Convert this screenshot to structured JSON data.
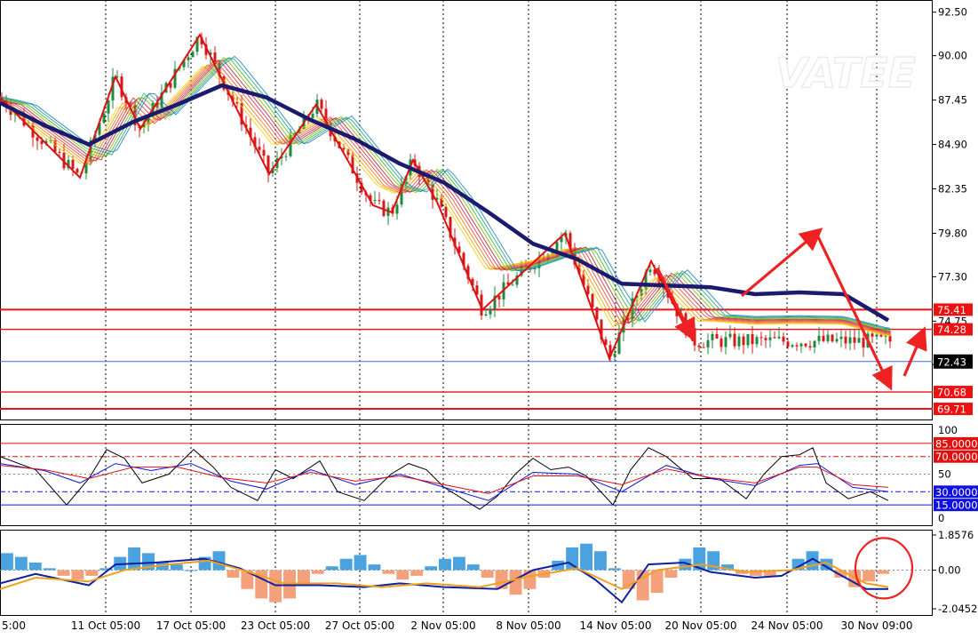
{
  "watermark": "VATEE",
  "colors": {
    "background": "#ffffff",
    "grid": "#000000",
    "bull_candle": "#1e8a3c",
    "bear_candle": "#d41a1a",
    "zigzag": "#dd1111",
    "ma_thick": "#1a1a6e",
    "level_line": "#ee1111",
    "price_line": "#3a6ad8",
    "rsi_black": "#000000",
    "rsi_red": "#e01010",
    "rsi_blue": "#1010e0",
    "macd_pos": "#4aa3df",
    "macd_neg": "#f4a07a",
    "macd_line": "#1020a0",
    "macd_signal": "#f0a020",
    "annotation": "#ee2222"
  },
  "chart_data": [
    {
      "type": "line",
      "panel": "price",
      "x_labels": [
        "5:00",
        "11 Oct 05:00",
        "17 Oct 05:00",
        "23 Oct 05:00",
        "27 Oct 05:00",
        "2 Nov 05:00",
        "8 Nov 05:00",
        "14 Nov 05:00",
        "20 Nov 05:00",
        "24 Nov 05:00",
        "30 Nov 09:00"
      ],
      "y_ticks": [
        "92.50",
        "90.00",
        "87.45",
        "84.90",
        "82.35",
        "79.80",
        "77.30",
        "74.75",
        "72.25"
      ],
      "ylim": [
        69.1,
        93.2
      ],
      "levels": [
        {
          "label": "75.41",
          "value": 75.41
        },
        {
          "label": "74.28",
          "value": 74.28
        },
        {
          "label": "70.68",
          "value": 70.68
        },
        {
          "label": "69.71",
          "value": 69.71
        }
      ],
      "current_price": {
        "label": "72.43",
        "value": 72.43
      },
      "series": [
        {
          "kind": "zigzag",
          "points": [
            [
              0,
              87.6
            ],
            [
              45,
              85.3
            ],
            [
              90,
              83.0
            ],
            [
              130,
              88.8
            ],
            [
              158,
              85.8
            ],
            [
              225,
              91.2
            ],
            [
              303,
              83.2
            ],
            [
              356,
              87.2
            ],
            [
              420,
              81.4
            ],
            [
              441,
              81.0
            ],
            [
              465,
              84.0
            ],
            [
              492,
              81.6
            ],
            [
              543,
              75.4
            ],
            [
              636,
              79.8
            ],
            [
              686,
              72.6
            ],
            [
              733,
              78.2
            ],
            [
              780,
              73.6
            ]
          ]
        },
        {
          "kind": "moving_average",
          "points": [
            [
              0,
              87.3
            ],
            [
              50,
              86.0
            ],
            [
              100,
              84.9
            ],
            [
              150,
              86.2
            ],
            [
              200,
              87.2
            ],
            [
              250,
              88.3
            ],
            [
              300,
              87.6
            ],
            [
              350,
              86.3
            ],
            [
              400,
              85.2
            ],
            [
              450,
              83.8
            ],
            [
              500,
              82.7
            ],
            [
              550,
              81.0
            ],
            [
              600,
              79.2
            ],
            [
              650,
              78.3
            ],
            [
              700,
              76.9
            ],
            [
              750,
              76.8
            ],
            [
              800,
              76.7
            ],
            [
              850,
              76.3
            ],
            [
              900,
              76.4
            ],
            [
              950,
              76.3
            ],
            [
              1000,
              74.8
            ]
          ]
        }
      ],
      "annotation_arrows": [
        [
          [
            740,
            77.8
          ],
          [
            778,
            74.0
          ]
        ],
        [
          [
            835,
            76.2
          ],
          [
            919,
            79.8
          ]
        ],
        [
          [
            919,
            79.8
          ],
          [
            1000,
            71.2
          ]
        ],
        [
          [
            1018,
            71.6
          ],
          [
            1038,
            74.0
          ]
        ]
      ]
    },
    {
      "type": "line",
      "panel": "rsi",
      "y_ticks": [
        "100",
        "50",
        "0"
      ],
      "ylim": [
        0,
        100
      ],
      "levels": [
        {
          "label": "85.0000",
          "value": 85,
          "color": "#e01010"
        },
        {
          "label": "70.0000",
          "value": 70,
          "color": "#e01010"
        },
        {
          "label": "30.0000",
          "value": 30,
          "color": "#1010e0"
        },
        {
          "label": "15.0000",
          "value": 15,
          "color": "#1010e0"
        }
      ],
      "series": [
        {
          "name": "",
          "color": "#000000",
          "points": [
            [
              0,
              70
            ],
            [
              40,
              55
            ],
            [
              75,
              15
            ],
            [
              100,
              45
            ],
            [
              120,
              78
            ],
            [
              140,
              68
            ],
            [
              160,
              40
            ],
            [
              190,
              50
            ],
            [
              218,
              78
            ],
            [
              240,
              58
            ],
            [
              260,
              35
            ],
            [
              290,
              20
            ],
            [
              310,
              55
            ],
            [
              330,
              45
            ],
            [
              360,
              65
            ],
            [
              380,
              30
            ],
            [
              410,
              20
            ],
            [
              440,
              50
            ],
            [
              460,
              62
            ],
            [
              480,
              55
            ],
            [
              500,
              35
            ],
            [
              540,
              10
            ],
            [
              560,
              25
            ],
            [
              580,
              50
            ],
            [
              600,
              68
            ],
            [
              620,
              55
            ],
            [
              640,
              58
            ],
            [
              660,
              48
            ],
            [
              690,
              15
            ],
            [
              710,
              55
            ],
            [
              730,
              80
            ],
            [
              750,
              70
            ],
            [
              780,
              45
            ],
            [
              810,
              45
            ],
            [
              840,
              22
            ],
            [
              860,
              50
            ],
            [
              880,
              70
            ],
            [
              900,
              72
            ],
            [
              915,
              80
            ],
            [
              930,
              40
            ],
            [
              955,
              22
            ],
            [
              980,
              30
            ],
            [
              1000,
              20
            ]
          ]
        },
        {
          "name": "",
          "color": "#1010e0",
          "points": [
            [
              0,
              62
            ],
            [
              50,
              54
            ],
            [
              90,
              40
            ],
            [
              130,
              62
            ],
            [
              170,
              54
            ],
            [
              215,
              62
            ],
            [
              260,
              42
            ],
            [
              300,
              33
            ],
            [
              350,
              55
            ],
            [
              400,
              38
            ],
            [
              450,
              50
            ],
            [
              500,
              35
            ],
            [
              550,
              20
            ],
            [
              600,
              52
            ],
            [
              650,
              50
            ],
            [
              700,
              30
            ],
            [
              750,
              60
            ],
            [
              800,
              45
            ],
            [
              850,
              37
            ],
            [
              900,
              60
            ],
            [
              920,
              62
            ],
            [
              960,
              35
            ],
            [
              1000,
              30
            ]
          ]
        },
        {
          "name": "",
          "color": "#e01010",
          "points": [
            [
              0,
              60
            ],
            [
              50,
              55
            ],
            [
              100,
              45
            ],
            [
              150,
              58
            ],
            [
              200,
              58
            ],
            [
              250,
              46
            ],
            [
              300,
              40
            ],
            [
              350,
              52
            ],
            [
              400,
              42
            ],
            [
              450,
              48
            ],
            [
              500,
              38
            ],
            [
              550,
              28
            ],
            [
              600,
              48
            ],
            [
              650,
              48
            ],
            [
              700,
              38
            ],
            [
              750,
              56
            ],
            [
              800,
              46
            ],
            [
              850,
              40
            ],
            [
              900,
              58
            ],
            [
              920,
              58
            ],
            [
              960,
              38
            ],
            [
              1000,
              35
            ]
          ]
        }
      ]
    },
    {
      "type": "bar",
      "panel": "macd",
      "y_ticks": [
        "1.8576",
        "0.00",
        "-2.0452"
      ],
      "ylim": [
        -2.0452,
        1.8576
      ],
      "histogram": [
        0.9,
        0.7,
        0.4,
        0.1,
        -0.3,
        -0.5,
        -0.3,
        0.1,
        0.7,
        1.2,
        0.9,
        0.4,
        0.3,
        0.0,
        0.7,
        1.0,
        -0.4,
        -1.0,
        -1.5,
        -1.7,
        -1.5,
        -0.8,
        -0.2,
        0.2,
        0.6,
        0.8,
        0.3,
        -0.2,
        -0.5,
        -0.3,
        0.2,
        0.6,
        0.7,
        0.3,
        -0.4,
        -1.0,
        -1.3,
        -1.0,
        -0.4,
        0.5,
        1.2,
        1.4,
        1.0,
        0.1,
        -1.0,
        -1.6,
        -1.2,
        -0.4,
        0.6,
        1.2,
        1.0,
        0.3,
        -0.2,
        -0.3,
        -0.3,
        0.0,
        0.6,
        1.0,
        0.6,
        -0.4,
        -0.9,
        -0.6,
        -0.2
      ],
      "series": [
        {
          "name": "",
          "color": "#1020a0",
          "points": [
            [
              0,
              -0.7
            ],
            [
              40,
              -0.2
            ],
            [
              100,
              -0.8
            ],
            [
              130,
              0.3
            ],
            [
              175,
              0.4
            ],
            [
              230,
              0.6
            ],
            [
              270,
              0.1
            ],
            [
              310,
              -0.8
            ],
            [
              360,
              -0.8
            ],
            [
              410,
              -0.9
            ],
            [
              450,
              -0.7
            ],
            [
              500,
              -0.9
            ],
            [
              560,
              -1.0
            ],
            [
              600,
              0.0
            ],
            [
              640,
              0.4
            ],
            [
              670,
              -0.5
            ],
            [
              700,
              -1.7
            ],
            [
              730,
              0.3
            ],
            [
              770,
              0.4
            ],
            [
              800,
              -0.1
            ],
            [
              850,
              -0.4
            ],
            [
              880,
              -0.3
            ],
            [
              915,
              0.6
            ],
            [
              940,
              -0.1
            ],
            [
              975,
              -1.0
            ],
            [
              1000,
              -1.0
            ]
          ]
        },
        {
          "name": "",
          "color": "#f0a020",
          "points": [
            [
              0,
              -1.0
            ],
            [
              40,
              -0.4
            ],
            [
              100,
              -0.6
            ],
            [
              140,
              0.0
            ],
            [
              190,
              0.3
            ],
            [
              235,
              0.5
            ],
            [
              280,
              -0.1
            ],
            [
              320,
              -0.7
            ],
            [
              380,
              -0.7
            ],
            [
              430,
              -0.9
            ],
            [
              480,
              -0.7
            ],
            [
              540,
              -0.9
            ],
            [
              600,
              -0.3
            ],
            [
              650,
              0.1
            ],
            [
              700,
              -1.0
            ],
            [
              740,
              0.0
            ],
            [
              790,
              0.3
            ],
            [
              840,
              -0.1
            ],
            [
              890,
              0.0
            ],
            [
              930,
              0.4
            ],
            [
              975,
              -0.7
            ],
            [
              1000,
              -0.9
            ]
          ]
        }
      ],
      "annotation_circle": {
        "center": [
          995,
          0.1
        ]
      }
    }
  ]
}
